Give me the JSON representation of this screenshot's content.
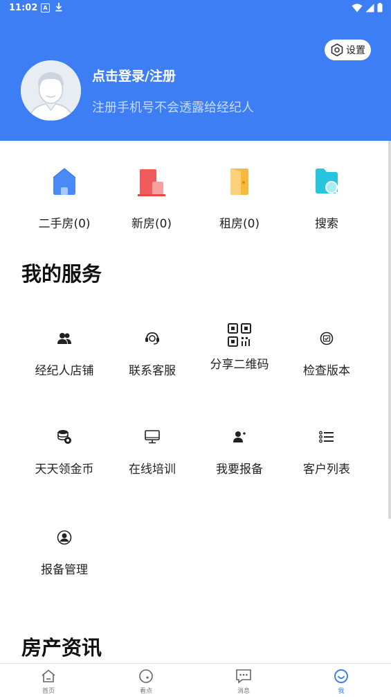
{
  "status_bar": {
    "time": "11:02",
    "app_icon_letter": "A"
  },
  "header": {
    "settings_label": "设置",
    "login_title": "点击登录/注册",
    "login_subtitle": "注册手机号不会透露给经纪人"
  },
  "quick_links": [
    {
      "label": "二手房(0)",
      "icon": "house-icon"
    },
    {
      "label": "新房(0)",
      "icon": "building-icon"
    },
    {
      "label": "租房(0)",
      "icon": "door-icon"
    },
    {
      "label": "搜索",
      "icon": "search-folder-icon"
    }
  ],
  "services": {
    "title": "我的服务",
    "items": [
      {
        "label": "经纪人店铺",
        "icon": "people-icon"
      },
      {
        "label": "联系客服",
        "icon": "headset-icon"
      },
      {
        "label": "分享二维码",
        "icon": "qrcode-icon"
      },
      {
        "label": "检查版本",
        "icon": "version-check-icon"
      },
      {
        "label": "天天领金币",
        "icon": "coins-icon"
      },
      {
        "label": "在线培训",
        "icon": "monitor-icon"
      },
      {
        "label": "我要报备",
        "icon": "person-add-icon"
      },
      {
        "label": "客户列表",
        "icon": "list-icon"
      },
      {
        "label": "报备管理",
        "icon": "user-circle-icon"
      }
    ]
  },
  "news": {
    "title": "房产资讯"
  },
  "tabbar": [
    {
      "label": "首页",
      "icon": "home-icon",
      "active": false
    },
    {
      "label": "看点",
      "icon": "discover-icon",
      "active": false
    },
    {
      "label": "消息",
      "icon": "message-icon",
      "active": false
    },
    {
      "label": "我",
      "icon": "smile-icon",
      "active": true
    }
  ],
  "colors": {
    "primary": "#3d7ef5",
    "header_bg": "#3d7ef5"
  }
}
